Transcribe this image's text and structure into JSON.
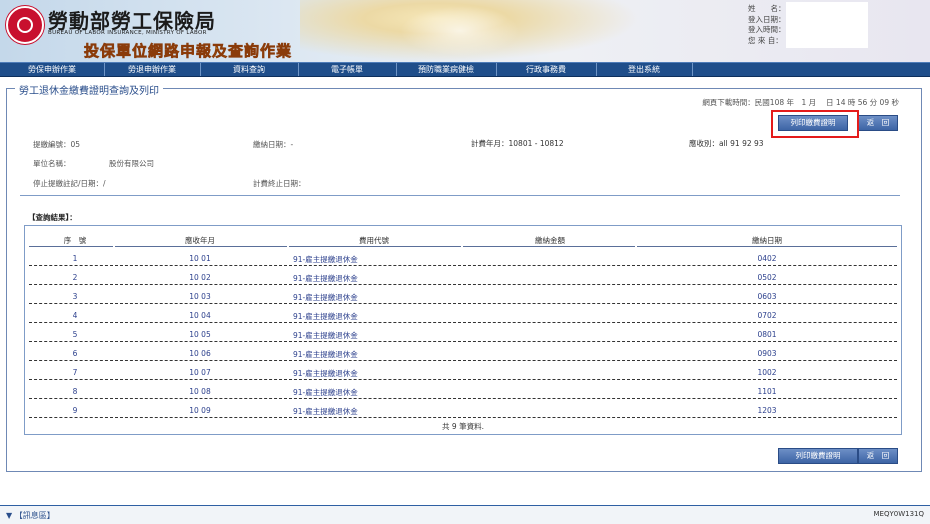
{
  "header": {
    "org_name": "勞動部勞工保險局",
    "org_en": "BUREAU OF LABOR INSURANCE, MINISTRY OF LABOR",
    "system_title": "投保單位網路申報及查詢作業",
    "user_labels": [
      "姓　　名：",
      "登入日期：",
      "登入時間：",
      "您 來 自："
    ]
  },
  "nav": [
    "勞保申辦作業",
    "勞退申辦作業",
    "資料查詢",
    "電子帳單",
    "預防職業病健檢",
    "行政事務費",
    "登出系統"
  ],
  "panel": {
    "title": "勞工退休金繳費證明查詢及列印",
    "download_time": "網頁下載時間：民國108 年　1 月　 日 14 時 56 分 09 秒",
    "print_button": "列印繳費證明",
    "back_button": "返　回"
  },
  "info": {
    "account_no": "提繳編號：05",
    "pay_date": "繳納日期：-",
    "period": "計費年月：10801 - 10812",
    "category": "應收別：all 91 92 93",
    "unit_name_label": "單位名稱：",
    "unit_name": "股份有限公司",
    "stop_date": "停止提繳註記/日期：/",
    "stop_billing": "計費終止日期："
  },
  "results_label": "【查詢結果】：",
  "table": {
    "headers": [
      "序　號",
      "應收年月",
      "費用代號",
      "繳納金額",
      "繳納日期"
    ],
    "rows": [
      [
        "1",
        "10 01",
        "91-雇主提繳退休金",
        "",
        "0402"
      ],
      [
        "2",
        "10 02",
        "91-雇主提繳退休金",
        "",
        "0502"
      ],
      [
        "3",
        "10 03",
        "91-雇主提繳退休金",
        "",
        "0603"
      ],
      [
        "4",
        "10 04",
        "91-雇主提繳退休金",
        "",
        "0702"
      ],
      [
        "5",
        "10 05",
        "91-雇主提繳退休金",
        "",
        "0801"
      ],
      [
        "6",
        "10 06",
        "91-雇主提繳退休金",
        "",
        "0903"
      ],
      [
        "7",
        "10 07",
        "91-雇主提繳退休金",
        "",
        "1002"
      ],
      [
        "8",
        "10 08",
        "91-雇主提繳退休金",
        "",
        "1101"
      ],
      [
        "9",
        "10 09",
        "91-雇主提繳退休金",
        "",
        "1203"
      ]
    ],
    "footer": "共 9 筆資料."
  },
  "bottom": {
    "message": "【訊息區】",
    "page_code": "MEQY0W131Q"
  },
  "colors": {
    "nav_bg": "#1f4e8a",
    "accent": "#2b4f8c",
    "highlight": "#e41b1b"
  }
}
